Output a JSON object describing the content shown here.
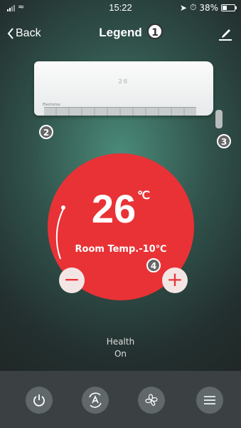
{
  "status_bar": {
    "time": "15:22",
    "battery": "38%"
  },
  "nav": {
    "back_label": "Back",
    "title": "Legend"
  },
  "device": {
    "display_value": "26",
    "brand": "Electrolux"
  },
  "control": {
    "set_temperature": "26",
    "unit": "℃",
    "room_temp_label": "Room Temp.-10℃"
  },
  "health": {
    "label": "Health",
    "value": "On"
  },
  "bottom": {
    "buttons": [
      {
        "name": "power",
        "icon": "power-icon"
      },
      {
        "name": "mode",
        "icon": "auto-mode-icon"
      },
      {
        "name": "fan",
        "icon": "fan-icon"
      },
      {
        "name": "menu",
        "icon": "menu-icon"
      }
    ]
  },
  "callouts": [
    "1",
    "2",
    "3",
    "4"
  ],
  "colors": {
    "accent": "#e93236",
    "bar": "#3b4143"
  }
}
